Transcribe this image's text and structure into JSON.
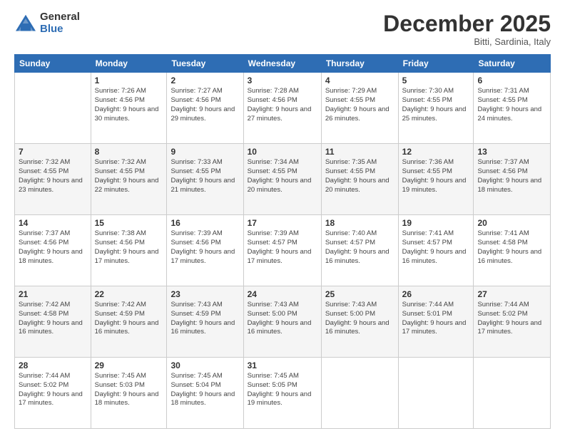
{
  "header": {
    "logo_general": "General",
    "logo_blue": "Blue",
    "month_title": "December 2025",
    "subtitle": "Bitti, Sardinia, Italy"
  },
  "weekdays": [
    "Sunday",
    "Monday",
    "Tuesday",
    "Wednesday",
    "Thursday",
    "Friday",
    "Saturday"
  ],
  "weeks": [
    [
      {
        "day": "",
        "info": ""
      },
      {
        "day": "1",
        "info": "Sunrise: 7:26 AM\nSunset: 4:56 PM\nDaylight: 9 hours\nand 30 minutes."
      },
      {
        "day": "2",
        "info": "Sunrise: 7:27 AM\nSunset: 4:56 PM\nDaylight: 9 hours\nand 29 minutes."
      },
      {
        "day": "3",
        "info": "Sunrise: 7:28 AM\nSunset: 4:56 PM\nDaylight: 9 hours\nand 27 minutes."
      },
      {
        "day": "4",
        "info": "Sunrise: 7:29 AM\nSunset: 4:55 PM\nDaylight: 9 hours\nand 26 minutes."
      },
      {
        "day": "5",
        "info": "Sunrise: 7:30 AM\nSunset: 4:55 PM\nDaylight: 9 hours\nand 25 minutes."
      },
      {
        "day": "6",
        "info": "Sunrise: 7:31 AM\nSunset: 4:55 PM\nDaylight: 9 hours\nand 24 minutes."
      }
    ],
    [
      {
        "day": "7",
        "info": "Sunrise: 7:32 AM\nSunset: 4:55 PM\nDaylight: 9 hours\nand 23 minutes."
      },
      {
        "day": "8",
        "info": "Sunrise: 7:32 AM\nSunset: 4:55 PM\nDaylight: 9 hours\nand 22 minutes."
      },
      {
        "day": "9",
        "info": "Sunrise: 7:33 AM\nSunset: 4:55 PM\nDaylight: 9 hours\nand 21 minutes."
      },
      {
        "day": "10",
        "info": "Sunrise: 7:34 AM\nSunset: 4:55 PM\nDaylight: 9 hours\nand 20 minutes."
      },
      {
        "day": "11",
        "info": "Sunrise: 7:35 AM\nSunset: 4:55 PM\nDaylight: 9 hours\nand 20 minutes."
      },
      {
        "day": "12",
        "info": "Sunrise: 7:36 AM\nSunset: 4:55 PM\nDaylight: 9 hours\nand 19 minutes."
      },
      {
        "day": "13",
        "info": "Sunrise: 7:37 AM\nSunset: 4:56 PM\nDaylight: 9 hours\nand 18 minutes."
      }
    ],
    [
      {
        "day": "14",
        "info": "Sunrise: 7:37 AM\nSunset: 4:56 PM\nDaylight: 9 hours\nand 18 minutes."
      },
      {
        "day": "15",
        "info": "Sunrise: 7:38 AM\nSunset: 4:56 PM\nDaylight: 9 hours\nand 17 minutes."
      },
      {
        "day": "16",
        "info": "Sunrise: 7:39 AM\nSunset: 4:56 PM\nDaylight: 9 hours\nand 17 minutes."
      },
      {
        "day": "17",
        "info": "Sunrise: 7:39 AM\nSunset: 4:57 PM\nDaylight: 9 hours\nand 17 minutes."
      },
      {
        "day": "18",
        "info": "Sunrise: 7:40 AM\nSunset: 4:57 PM\nDaylight: 9 hours\nand 16 minutes."
      },
      {
        "day": "19",
        "info": "Sunrise: 7:41 AM\nSunset: 4:57 PM\nDaylight: 9 hours\nand 16 minutes."
      },
      {
        "day": "20",
        "info": "Sunrise: 7:41 AM\nSunset: 4:58 PM\nDaylight: 9 hours\nand 16 minutes."
      }
    ],
    [
      {
        "day": "21",
        "info": "Sunrise: 7:42 AM\nSunset: 4:58 PM\nDaylight: 9 hours\nand 16 minutes."
      },
      {
        "day": "22",
        "info": "Sunrise: 7:42 AM\nSunset: 4:59 PM\nDaylight: 9 hours\nand 16 minutes."
      },
      {
        "day": "23",
        "info": "Sunrise: 7:43 AM\nSunset: 4:59 PM\nDaylight: 9 hours\nand 16 minutes."
      },
      {
        "day": "24",
        "info": "Sunrise: 7:43 AM\nSunset: 5:00 PM\nDaylight: 9 hours\nand 16 minutes."
      },
      {
        "day": "25",
        "info": "Sunrise: 7:43 AM\nSunset: 5:00 PM\nDaylight: 9 hours\nand 16 minutes."
      },
      {
        "day": "26",
        "info": "Sunrise: 7:44 AM\nSunset: 5:01 PM\nDaylight: 9 hours\nand 17 minutes."
      },
      {
        "day": "27",
        "info": "Sunrise: 7:44 AM\nSunset: 5:02 PM\nDaylight: 9 hours\nand 17 minutes."
      }
    ],
    [
      {
        "day": "28",
        "info": "Sunrise: 7:44 AM\nSunset: 5:02 PM\nDaylight: 9 hours\nand 17 minutes."
      },
      {
        "day": "29",
        "info": "Sunrise: 7:45 AM\nSunset: 5:03 PM\nDaylight: 9 hours\nand 18 minutes."
      },
      {
        "day": "30",
        "info": "Sunrise: 7:45 AM\nSunset: 5:04 PM\nDaylight: 9 hours\nand 18 minutes."
      },
      {
        "day": "31",
        "info": "Sunrise: 7:45 AM\nSunset: 5:05 PM\nDaylight: 9 hours\nand 19 minutes."
      },
      {
        "day": "",
        "info": ""
      },
      {
        "day": "",
        "info": ""
      },
      {
        "day": "",
        "info": ""
      }
    ]
  ]
}
